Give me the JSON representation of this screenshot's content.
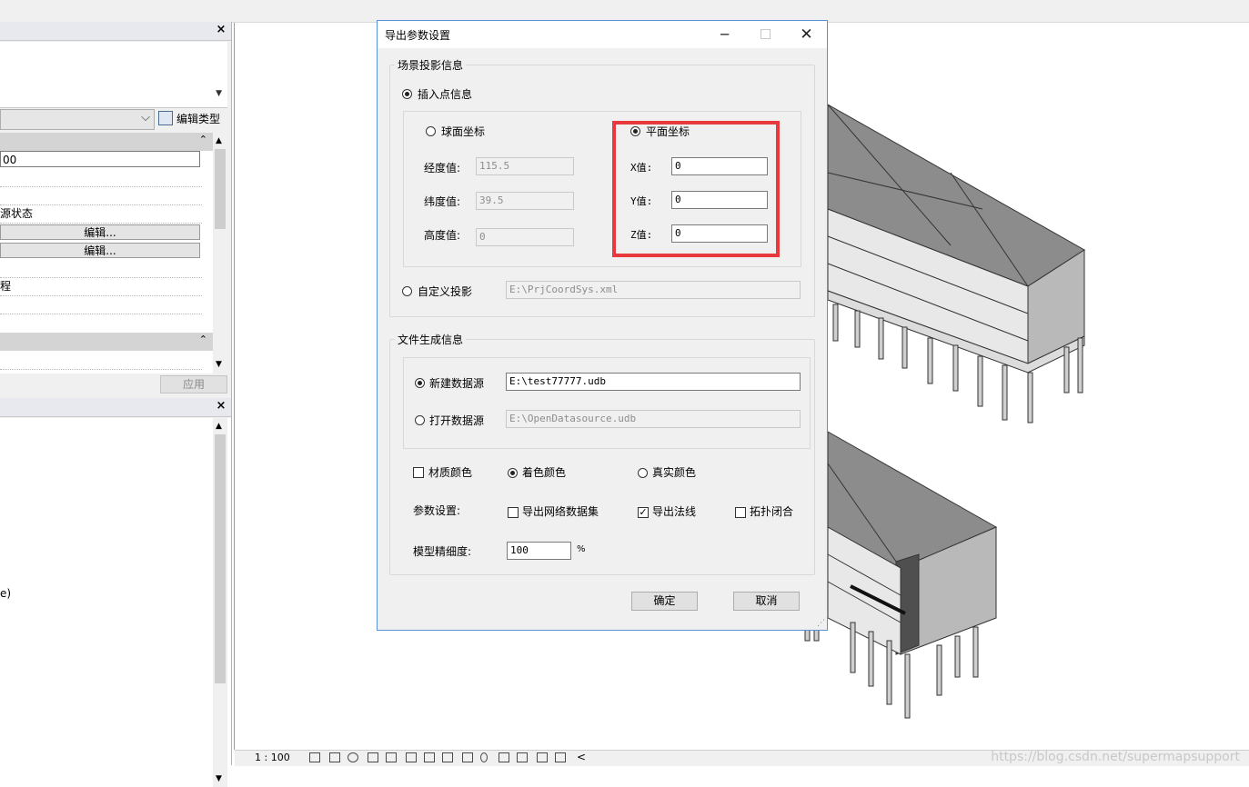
{
  "leftpanel": {
    "close_glyph": "×",
    "edit_type_label": "编辑类型",
    "value_100": "00",
    "row_source_state": "源状态",
    "edit1": "编辑...",
    "edit2": "编辑...",
    "row_process": "程",
    "apply_label": "应用",
    "browser_text": "e)"
  },
  "status": {
    "scale": "1 : 100",
    "watermark": "https://blog.csdn.net/supermapsupport",
    "arrow": "<"
  },
  "dialog": {
    "title": "导出参数设置",
    "min_glyph": "─",
    "max_glyph": "☐",
    "close_glyph": "✕",
    "scene": {
      "legend": "场景投影信息",
      "insert_point": "插入点信息",
      "spherical": "球面坐标",
      "planar": "平面坐标",
      "lon_label": "经度值:",
      "lon_value": "115.5",
      "lat_label": "纬度值:",
      "lat_value": "39.5",
      "height_label": "高度值:",
      "height_value": "0",
      "x_label": "X值:",
      "x_value": "0",
      "y_label": "Y值:",
      "y_value": "0",
      "z_label": "Z值:",
      "z_value": "0",
      "custom_proj": "自定义投影",
      "custom_proj_path": "E:\\PrjCoordSys.xml"
    },
    "file": {
      "legend": "文件生成信息",
      "new_ds": "新建数据源",
      "new_ds_path": "E:\\test77777.udb",
      "open_ds": "打开数据源",
      "open_ds_path": "E:\\OpenDatasource.udb"
    },
    "material_color": "材质颜色",
    "shade_color": "着色颜色",
    "true_color": "真实颜色",
    "params_label": "参数设置:",
    "export_network": "导出网络数据集",
    "export_normal": "导出法线",
    "topo_close": "拓扑闭合",
    "precision_label": "模型精细度:",
    "precision_value": "100",
    "percent": "%",
    "ok": "确定",
    "cancel": "取消",
    "grip": "⋰"
  }
}
